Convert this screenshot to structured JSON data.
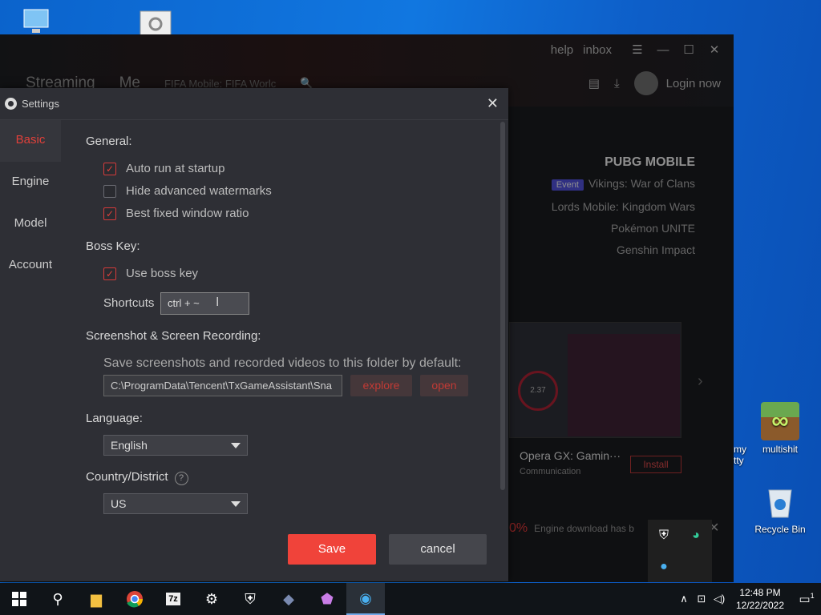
{
  "desktop": {
    "icons": [
      {
        "label": "multishit"
      },
      {
        "label": "Recycle Bin"
      }
    ],
    "partial_label": "my\ntty"
  },
  "app": {
    "top_links": [
      "help",
      "inbox"
    ],
    "nav": [
      "Streaming",
      "Me"
    ],
    "search_text": "FIFA Mobile: FIFA Worlc",
    "login": "Login now",
    "games": {
      "head": "PUBG MOBILE",
      "event_badge": "Event",
      "items": [
        "Vikings: War of Clans",
        "Lords Mobile: Kingdom Wars",
        "Pokémon UNITE",
        "Genshin Impact"
      ]
    },
    "promo": {
      "title": "Opera GX: Gamin···",
      "category": "Communication",
      "install": "Install",
      "gauge": "2.37"
    },
    "download": {
      "percent": "0%",
      "text": "Engine download has b"
    }
  },
  "settings": {
    "title": "Settings",
    "sidebar": [
      {
        "label": "Basic",
        "active": true
      },
      {
        "label": "Engine",
        "active": false
      },
      {
        "label": "Model",
        "active": false
      },
      {
        "label": "Account",
        "active": false
      }
    ],
    "general": {
      "heading": "General:",
      "options": [
        {
          "label": "Auto run at startup",
          "checked": true
        },
        {
          "label": "Hide advanced watermarks",
          "checked": false
        },
        {
          "label": "Best fixed window ratio",
          "checked": true
        }
      ]
    },
    "boss_key": {
      "heading": "Boss Key:",
      "use_label": "Use boss key",
      "use_checked": true,
      "shortcuts_label": "Shortcuts",
      "shortcut_value": "ctrl + ~"
    },
    "screenshot": {
      "heading": "Screenshot & Screen Recording:",
      "folder_label": "Save screenshots and recorded videos to this folder by default:",
      "path": "C:\\ProgramData\\Tencent\\TxGameAssistant\\Sna",
      "explore": "explore",
      "open": "open"
    },
    "language": {
      "heading": "Language:",
      "value": "English"
    },
    "country": {
      "heading": "Country/District",
      "value": "US"
    },
    "save": "Save",
    "cancel": "cancel"
  },
  "taskbar": {
    "time": "12:48 PM",
    "date": "12/22/2022",
    "notification_count": "1"
  },
  "colors": {
    "accent": "#f0433a",
    "dialog_bg": "#2e2f35",
    "taskbar_bg": "#101418"
  }
}
